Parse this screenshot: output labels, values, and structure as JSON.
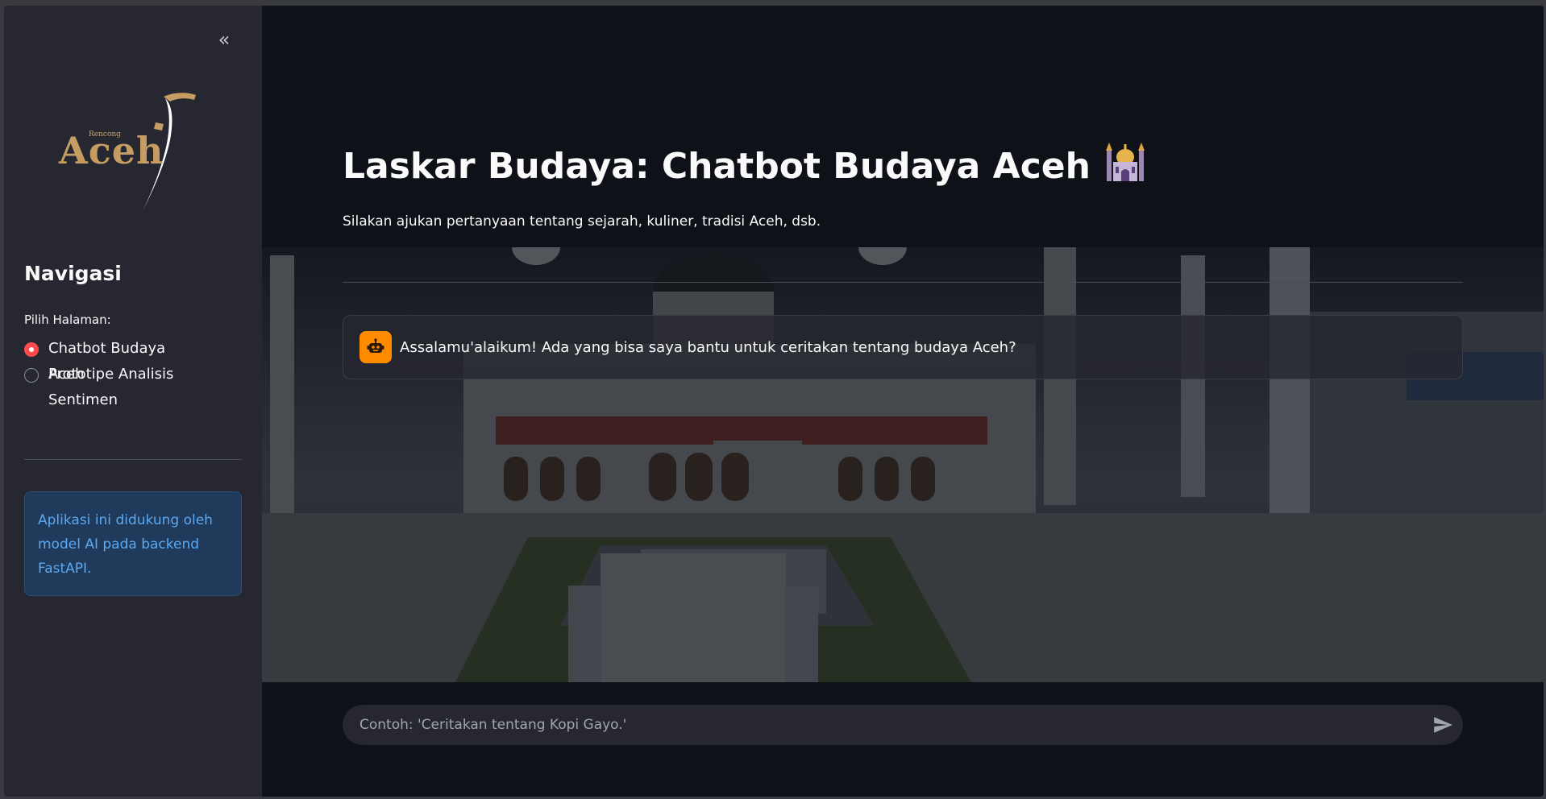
{
  "sidebar": {
    "collapse_glyph": "«",
    "logo": {
      "small_text": "Rencong",
      "big_text": "Aceh"
    },
    "nav_title": "Navigasi",
    "nav_label": "Pilih Halaman:",
    "options": [
      {
        "label": "Chatbot Budaya Aceh",
        "selected": true
      },
      {
        "label": "Prototipe Analisis Sentimen",
        "selected": false
      }
    ],
    "info_text": "Aplikasi ini didukung oleh model AI pada backend FastAPI."
  },
  "main": {
    "title": "Laskar Budaya: Chatbot Budaya Aceh",
    "title_emoji": "mosque-icon",
    "subtitle": "Silakan ajukan pertanyaan tentang sejarah, kuliner, tradisi Aceh, dsb.",
    "messages": [
      {
        "role": "assistant",
        "avatar_icon": "robot-icon",
        "text": "Assalamu'alaikum! Ada yang bisa saya bantu untuk ceritakan tentang budaya Aceh?"
      }
    ],
    "chat_input": {
      "placeholder": "Contoh: 'Ceritakan tentang Kopi Gayo.'",
      "value": ""
    }
  },
  "colors": {
    "sidebar_bg": "#262730",
    "main_bg": "#0e1117",
    "accent_radio": "#ff4b4b",
    "avatar_bg": "#ff8c00",
    "info_bg": "#1f3a5a",
    "info_text": "#5aa9f2",
    "logo_gold": "#c59d62"
  }
}
